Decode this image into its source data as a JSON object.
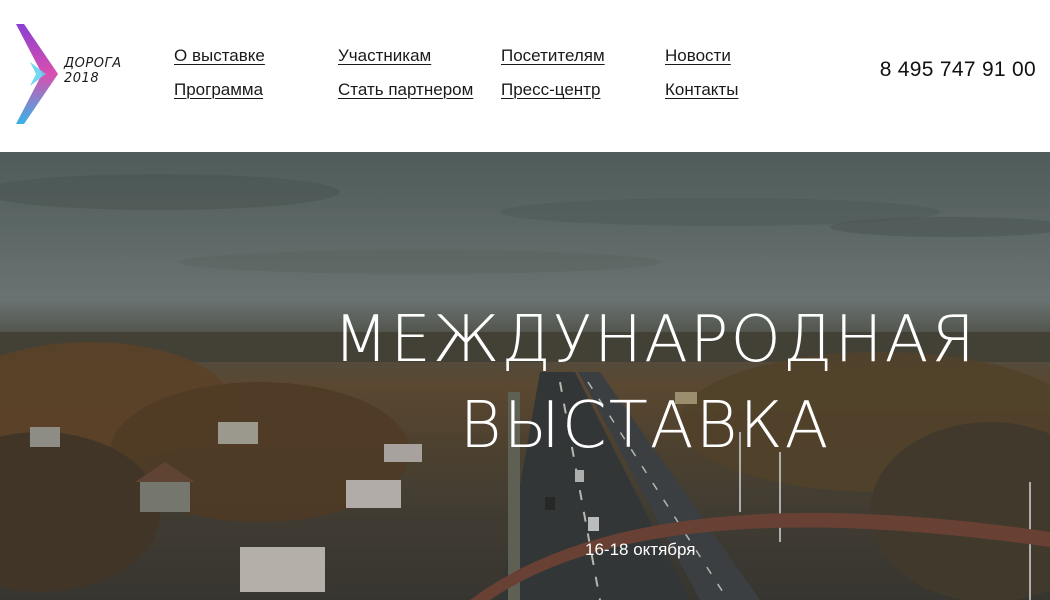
{
  "logo": {
    "line1": "ДОРОГА",
    "line2": "2018"
  },
  "nav": {
    "columns": [
      [
        "О выставке",
        "Программа"
      ],
      [
        "Участникам",
        "Стать партнером"
      ],
      [
        "Посетителям",
        "Пресс-центр"
      ],
      [
        "Новости",
        "Контакты"
      ]
    ]
  },
  "phone": "8 495 747 91 00",
  "hero": {
    "title_line1": "МЕЖДУНАРОДНАЯ",
    "title_line2": "ВЫСТАВКА",
    "date": "16-18 октября"
  }
}
